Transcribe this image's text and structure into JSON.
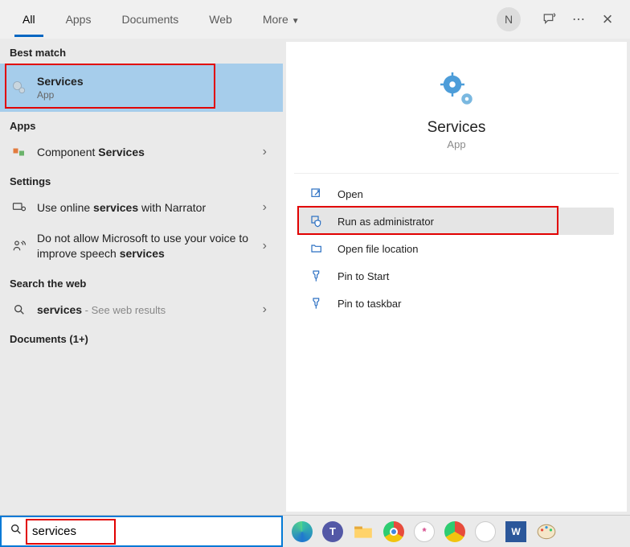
{
  "tabs": [
    "All",
    "Apps",
    "Documents",
    "Web",
    "More"
  ],
  "active_tab": 0,
  "avatar": "N",
  "left": {
    "best_match_header": "Best match",
    "best_match": {
      "title": "Services",
      "sub": "App"
    },
    "apps_header": "Apps",
    "apps_item_prefix": "Component ",
    "apps_item_bold": "Services",
    "settings_header": "Settings",
    "setting1_pre": "Use online ",
    "setting1_bold": "services",
    "setting1_post": " with Narrator",
    "setting2_pre": "Do not allow Microsoft to use your voice to improve speech ",
    "setting2_bold": "services",
    "web_header": "Search the web",
    "web_item_bold": "services",
    "web_item_suffix": " - See web results",
    "docs_header": "Documents (1+)"
  },
  "preview": {
    "title": "Services",
    "sub": "App",
    "actions": [
      {
        "icon": "open",
        "label": "Open"
      },
      {
        "icon": "admin",
        "label": "Run as administrator"
      },
      {
        "icon": "folder",
        "label": "Open file location"
      },
      {
        "icon": "pin",
        "label": "Pin to Start"
      },
      {
        "icon": "pin",
        "label": "Pin to taskbar"
      }
    ]
  },
  "search_value": "services"
}
